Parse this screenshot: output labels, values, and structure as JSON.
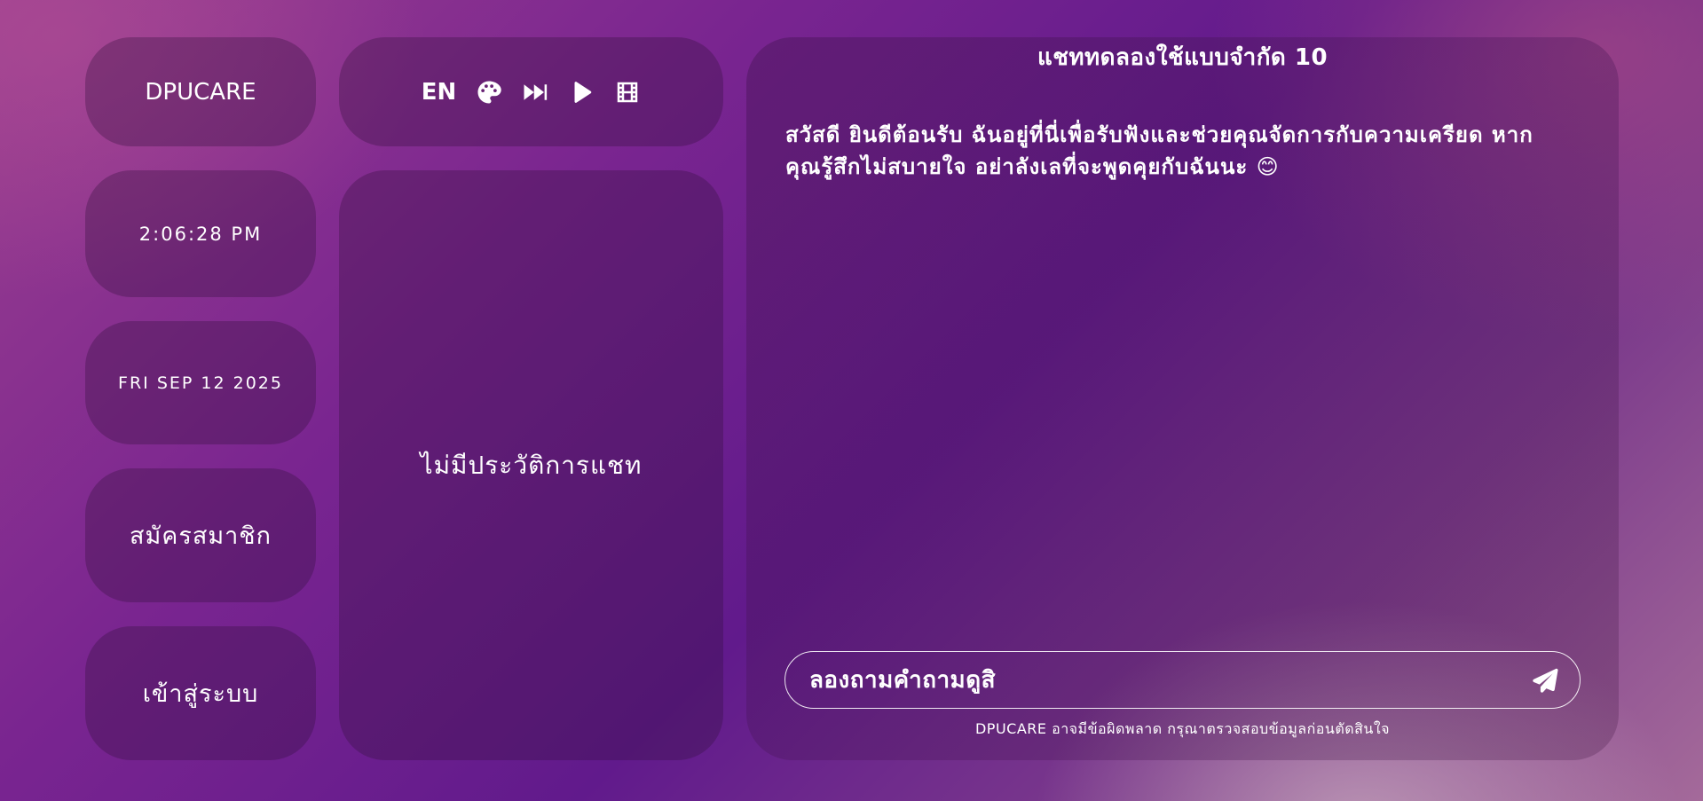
{
  "brand": {
    "name": "DPUCARE"
  },
  "clock": {
    "time": "2:06:28 PM"
  },
  "date": {
    "text": "FRI SEP 12 2025"
  },
  "auth": {
    "signup_label": "สมัครสมาชิก",
    "login_label": "เข้าสู่ระบบ"
  },
  "toolbar": {
    "language_label": "EN",
    "icons": [
      "palette-icon",
      "fast-forward-icon",
      "play-icon",
      "film-icon"
    ]
  },
  "history": {
    "empty_text": "ไม่มีประวัติการแชท"
  },
  "chat": {
    "title": "แชททดลองใช้แบบจำกัด 10",
    "greeting": "สวัสดี ยินดีต้อนรับ ฉันอยู่ที่นี่เพื่อรับฟังและช่วยคุณจัดการกับความเครียด หากคุณรู้สึกไม่สบายใจ อย่าลังเลที่จะพูดคุยกับฉันนะ 😊",
    "input_placeholder": "ลองถามคำถามดูสิ",
    "disclaimer": "DPUCARE อาจมีข้อผิดพลาด กรุณาตรวจสอบข้อมูลก่อนตัดสินใจ"
  }
}
